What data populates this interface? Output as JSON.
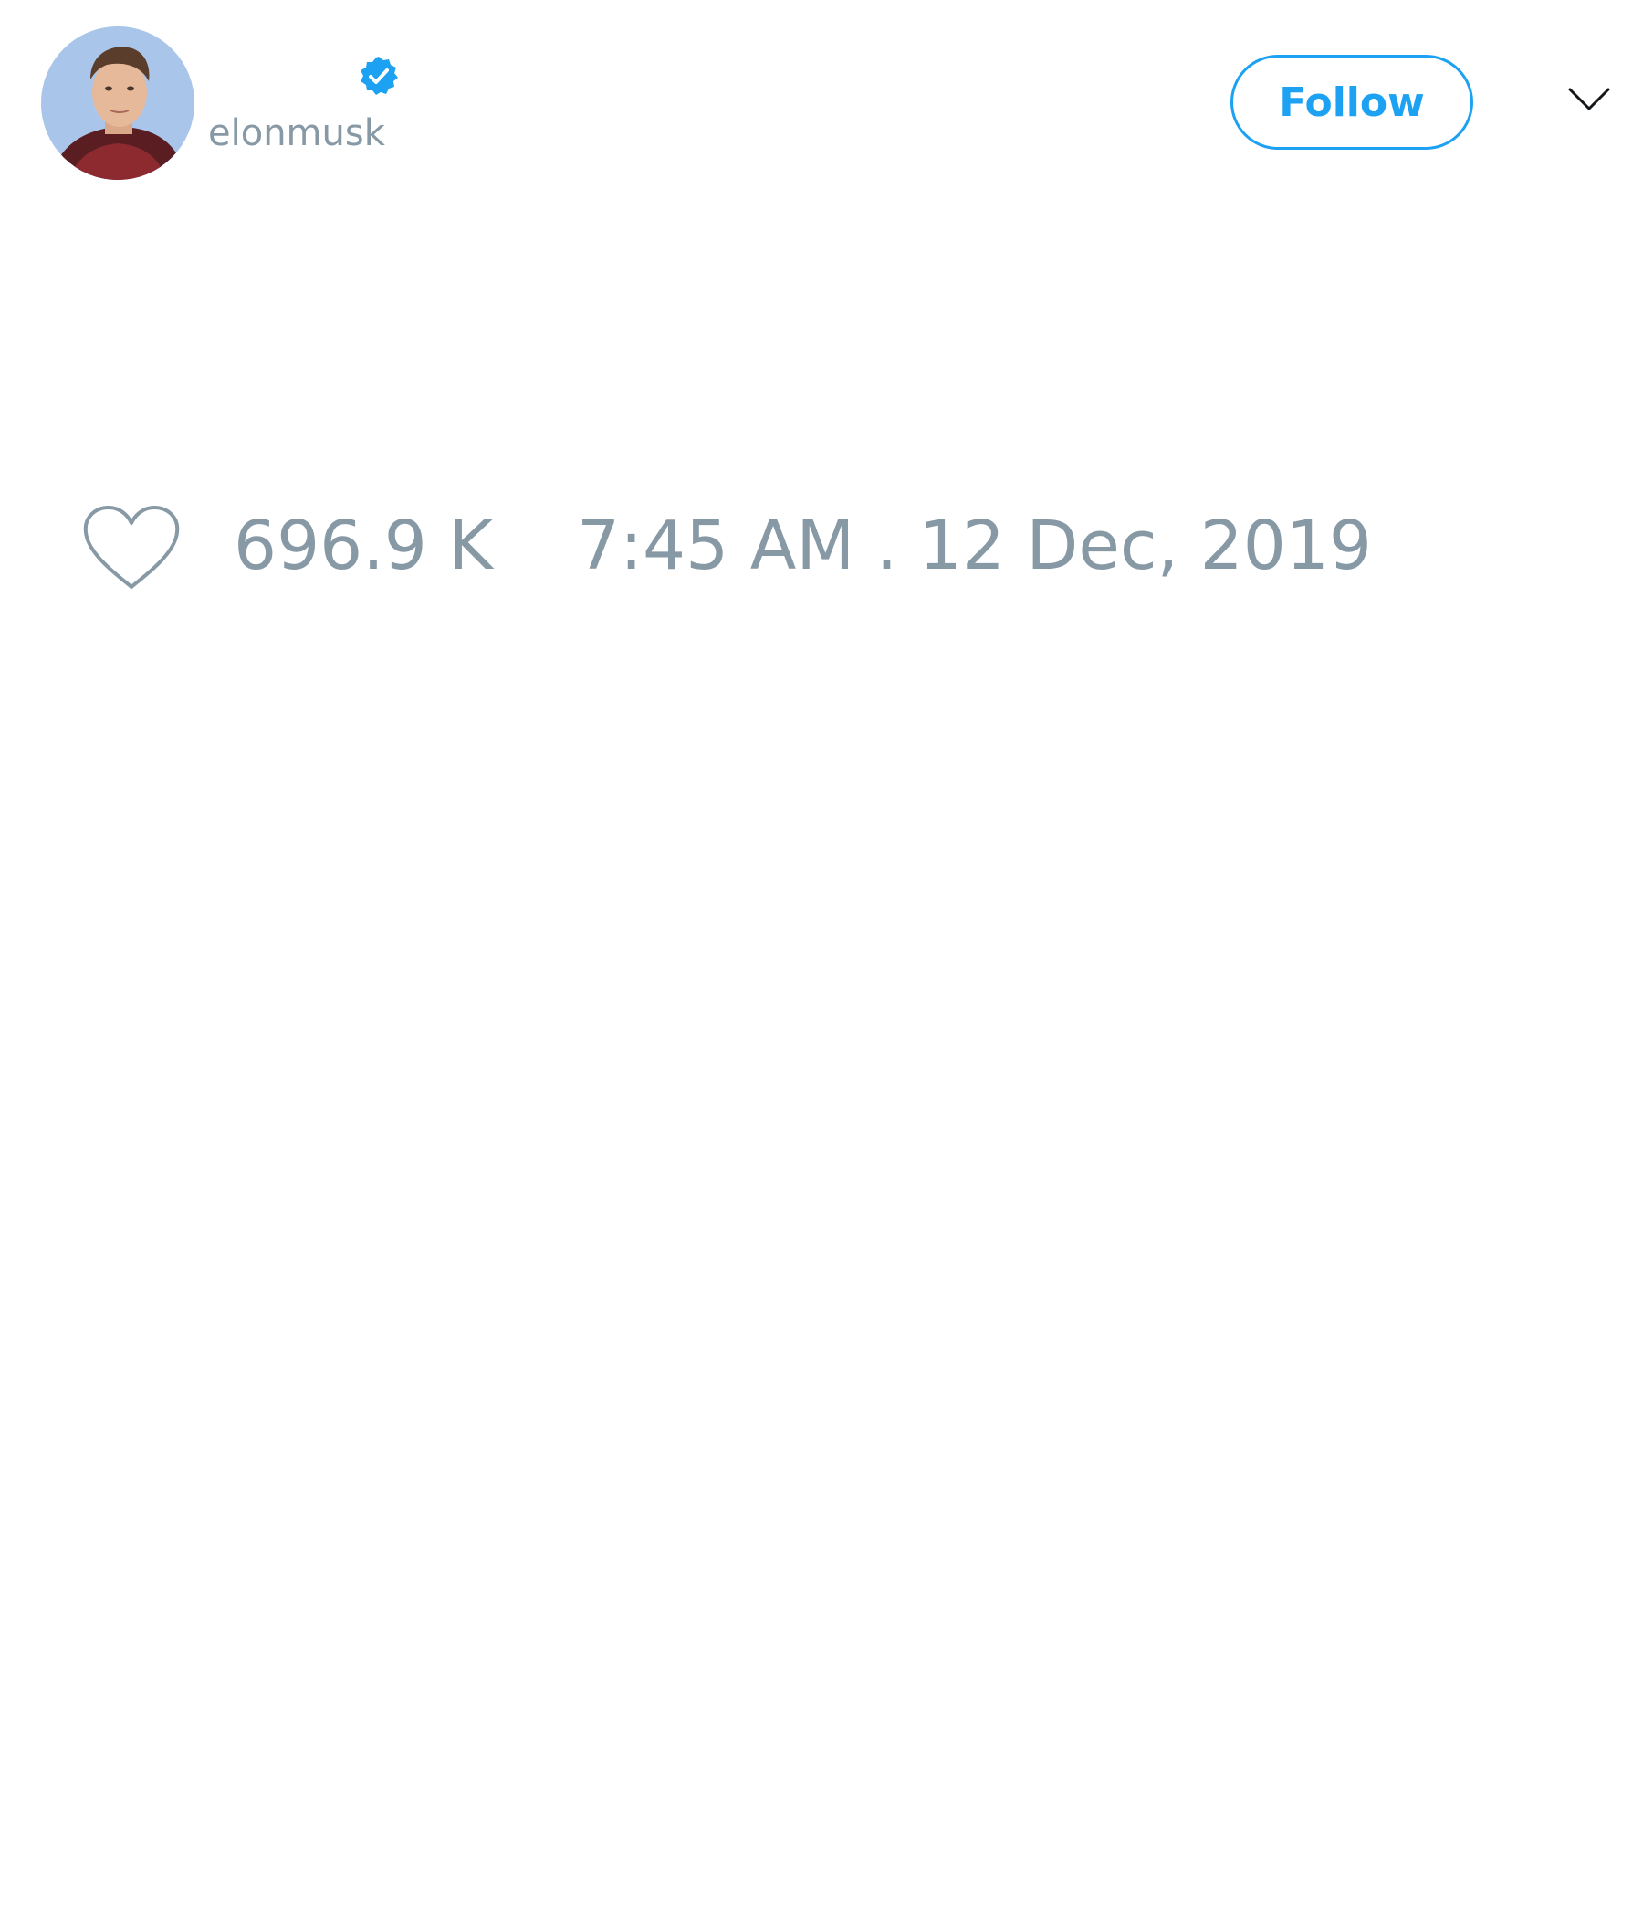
{
  "author": {
    "display_name": "",
    "handle": "elonmusk",
    "verified": true
  },
  "actions": {
    "follow_label": "Follow"
  },
  "icons": {
    "verified": "verified-badge-icon",
    "menu": "chevron-down-icon",
    "like": "heart-icon"
  },
  "stats": {
    "likes": "696.9 K",
    "timestamp": "7:45 AM . 12 Dec, 2019"
  },
  "colors": {
    "accent": "#1da1f2",
    "muted_text": "#8899a6",
    "background": "#ffffff"
  }
}
